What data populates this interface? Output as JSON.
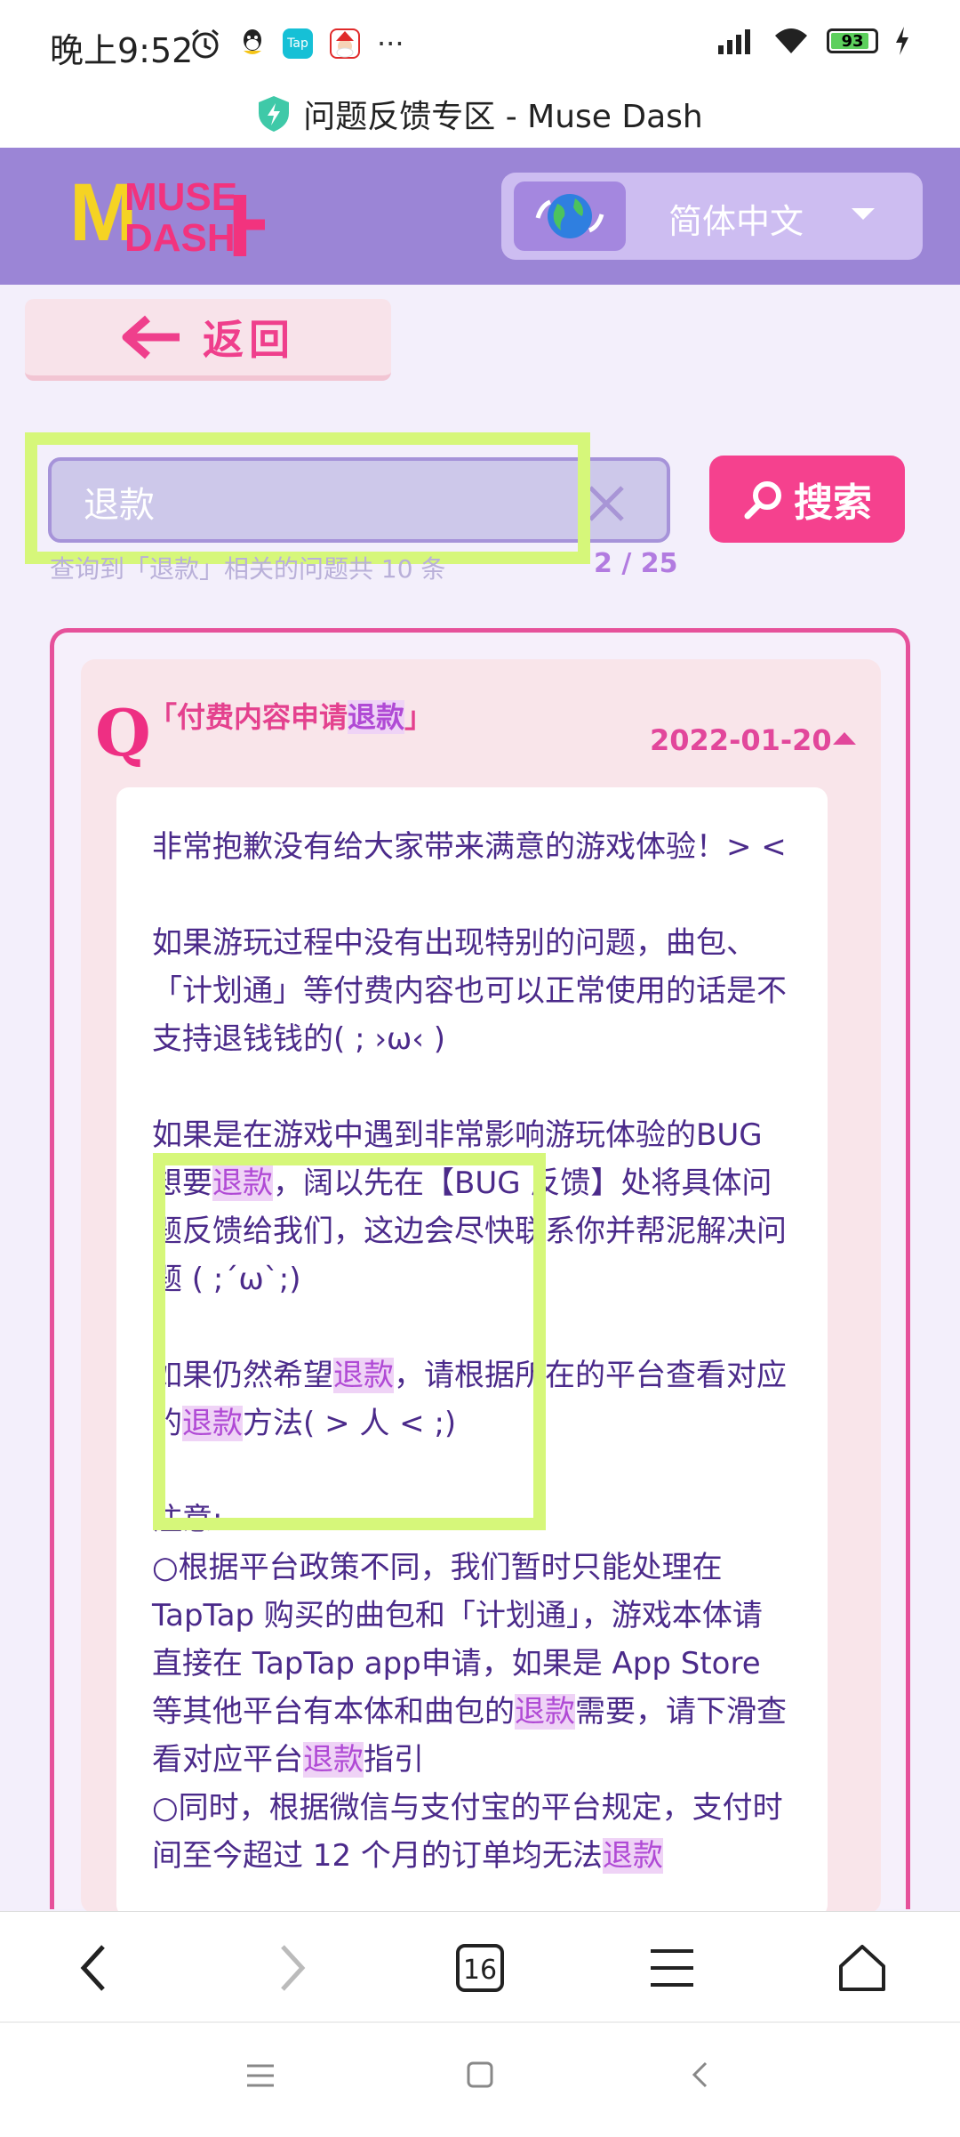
{
  "status_bar": {
    "time": "晚上9:52",
    "more": "···",
    "battery": "93"
  },
  "browser": {
    "page_title": "问题反馈专区 - Muse Dash",
    "tab_count": "16"
  },
  "header": {
    "logo_text_top": "MUSE",
    "logo_text_bottom": "DASH",
    "language": "简体中文"
  },
  "back_button": {
    "label": "返回"
  },
  "search": {
    "value": "退款",
    "button_label": "搜索",
    "result_info": "查询到「退款」相关的问题共 10 条",
    "page_indicator": "2 / 25"
  },
  "faq": {
    "question": "「付费内容申请退款」",
    "date": "2022-01-20",
    "answer": {
      "p1": "非常抱歉没有给大家带来满意的游戏体验！> <",
      "p2": "如果游玩过程中没有出现特别的问题，曲包、「计划通」等付费内容也可以正常使用的话是不支持退钱钱的( ; ›ω‹ )",
      "p3a": "如果是在游戏中遇到非常影响游玩体验的BUG 想要",
      "p3b": "，阔以先在【BUG 反馈】处将具体问题反馈给我们，这边会尽快联系你并帮泥解决问题 ( ;´ω`;)",
      "p4a": "如果仍然希望",
      "p4b": "，请根据所在的平台查看对应的",
      "p4c": "方法( > 人 < ;)",
      "note_label": "注意:",
      "n1a": "○根据平台政策不同，我们暂时只能处理在 TapTap 购买的曲包和「计划通」，游戏本体请直接在 TapTap app申请，如果是 App Store 等其他平台有本体和曲包的",
      "n1b": "需要，请下滑查看对应平台",
      "n1c": "指引",
      "n2a": "○同时，根据微信与支付宝的平台规定，支付时间至今超过 12 个月的订单均无法",
      "keyword": "退款"
    }
  },
  "colors": {
    "header_bg": "#9b85d6",
    "accent_pink": "#f5418e",
    "text_purple": "#4b2a8a",
    "highlight_green": "#d6f77a"
  },
  "icons": [
    "alarm-icon",
    "qq-icon",
    "taptap-icon",
    "santa-icon",
    "signal-icon",
    "wifi-icon",
    "charging-icon",
    "shield-icon",
    "globe-icon",
    "dropdown-caret-icon",
    "back-arrow-icon",
    "clear-icon",
    "search-icon",
    "collapse-caret-icon",
    "nav-back-icon",
    "nav-forward-icon",
    "tabs-icon",
    "menu-icon",
    "home-icon"
  ]
}
